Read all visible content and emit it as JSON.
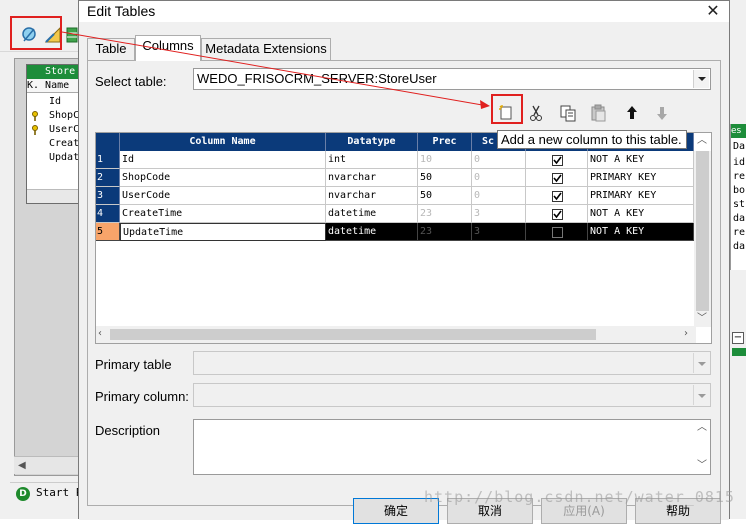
{
  "background_app": {
    "entity": {
      "title": "Store",
      "header": "K. Name",
      "rows": [
        "Id",
        "ShopC",
        "UserC",
        "Creat",
        "Updat"
      ]
    },
    "right_panel": {
      "lines": [
        "Da",
        "id",
        "re",
        "bo",
        "st",
        "da",
        "re",
        "da"
      ]
    },
    "status_label": "Start Pr"
  },
  "dialog": {
    "title": "Edit Tables",
    "tabs": [
      {
        "label": "Table",
        "active": false
      },
      {
        "label": "Columns",
        "active": true
      },
      {
        "label": "Metadata Extensions",
        "active": false
      }
    ],
    "select_table": {
      "label": "Select table:",
      "value": "WEDO_FRISOCRM_SERVER:StoreUser"
    },
    "toolbar": {
      "icons": [
        "add-column-icon",
        "cut-icon",
        "copy-icon",
        "paste-icon",
        "move-up-icon",
        "move-down-icon"
      ]
    },
    "tooltip": "Add a new column to this table.",
    "grid": {
      "headers": [
        "Column Name",
        "Datatype",
        "Prec",
        "Sc"
      ],
      "rows": [
        {
          "num": "1",
          "name": "Id",
          "datatype": "int",
          "prec": "10",
          "scale": "0",
          "checked": true,
          "key": "NOT A KEY"
        },
        {
          "num": "2",
          "name": "ShopCode",
          "datatype": "nvarchar",
          "prec": "50",
          "scale": "0",
          "checked": true,
          "key": "PRIMARY KEY"
        },
        {
          "num": "3",
          "name": "UserCode",
          "datatype": "nvarchar",
          "prec": "50",
          "scale": "0",
          "checked": true,
          "key": "PRIMARY KEY"
        },
        {
          "num": "4",
          "name": "CreateTime",
          "datatype": "datetime",
          "prec": "23",
          "scale": "3",
          "checked": true,
          "key": "NOT A KEY"
        },
        {
          "num": "5",
          "name": "UpdateTime",
          "datatype": "datetime",
          "prec": "23",
          "scale": "3",
          "checked": false,
          "key": "NOT A KEY"
        }
      ]
    },
    "primary_table": {
      "label": "Primary table",
      "value": ""
    },
    "primary_column": {
      "label": "Primary column:",
      "value": ""
    },
    "description": {
      "label": "Description",
      "value": ""
    },
    "buttons": {
      "ok": "确定",
      "cancel": "取消",
      "apply": "应用(A)",
      "help": "帮助"
    },
    "watermark": "http://blog.csdn.net/water_0815"
  },
  "colors": {
    "grid_header": "#0b3a7a",
    "selected_row": "#000000",
    "selected_row_number": "#f7a46a",
    "annotation_red": "#e0201f",
    "entity_title_green": "#1d8d3a"
  }
}
